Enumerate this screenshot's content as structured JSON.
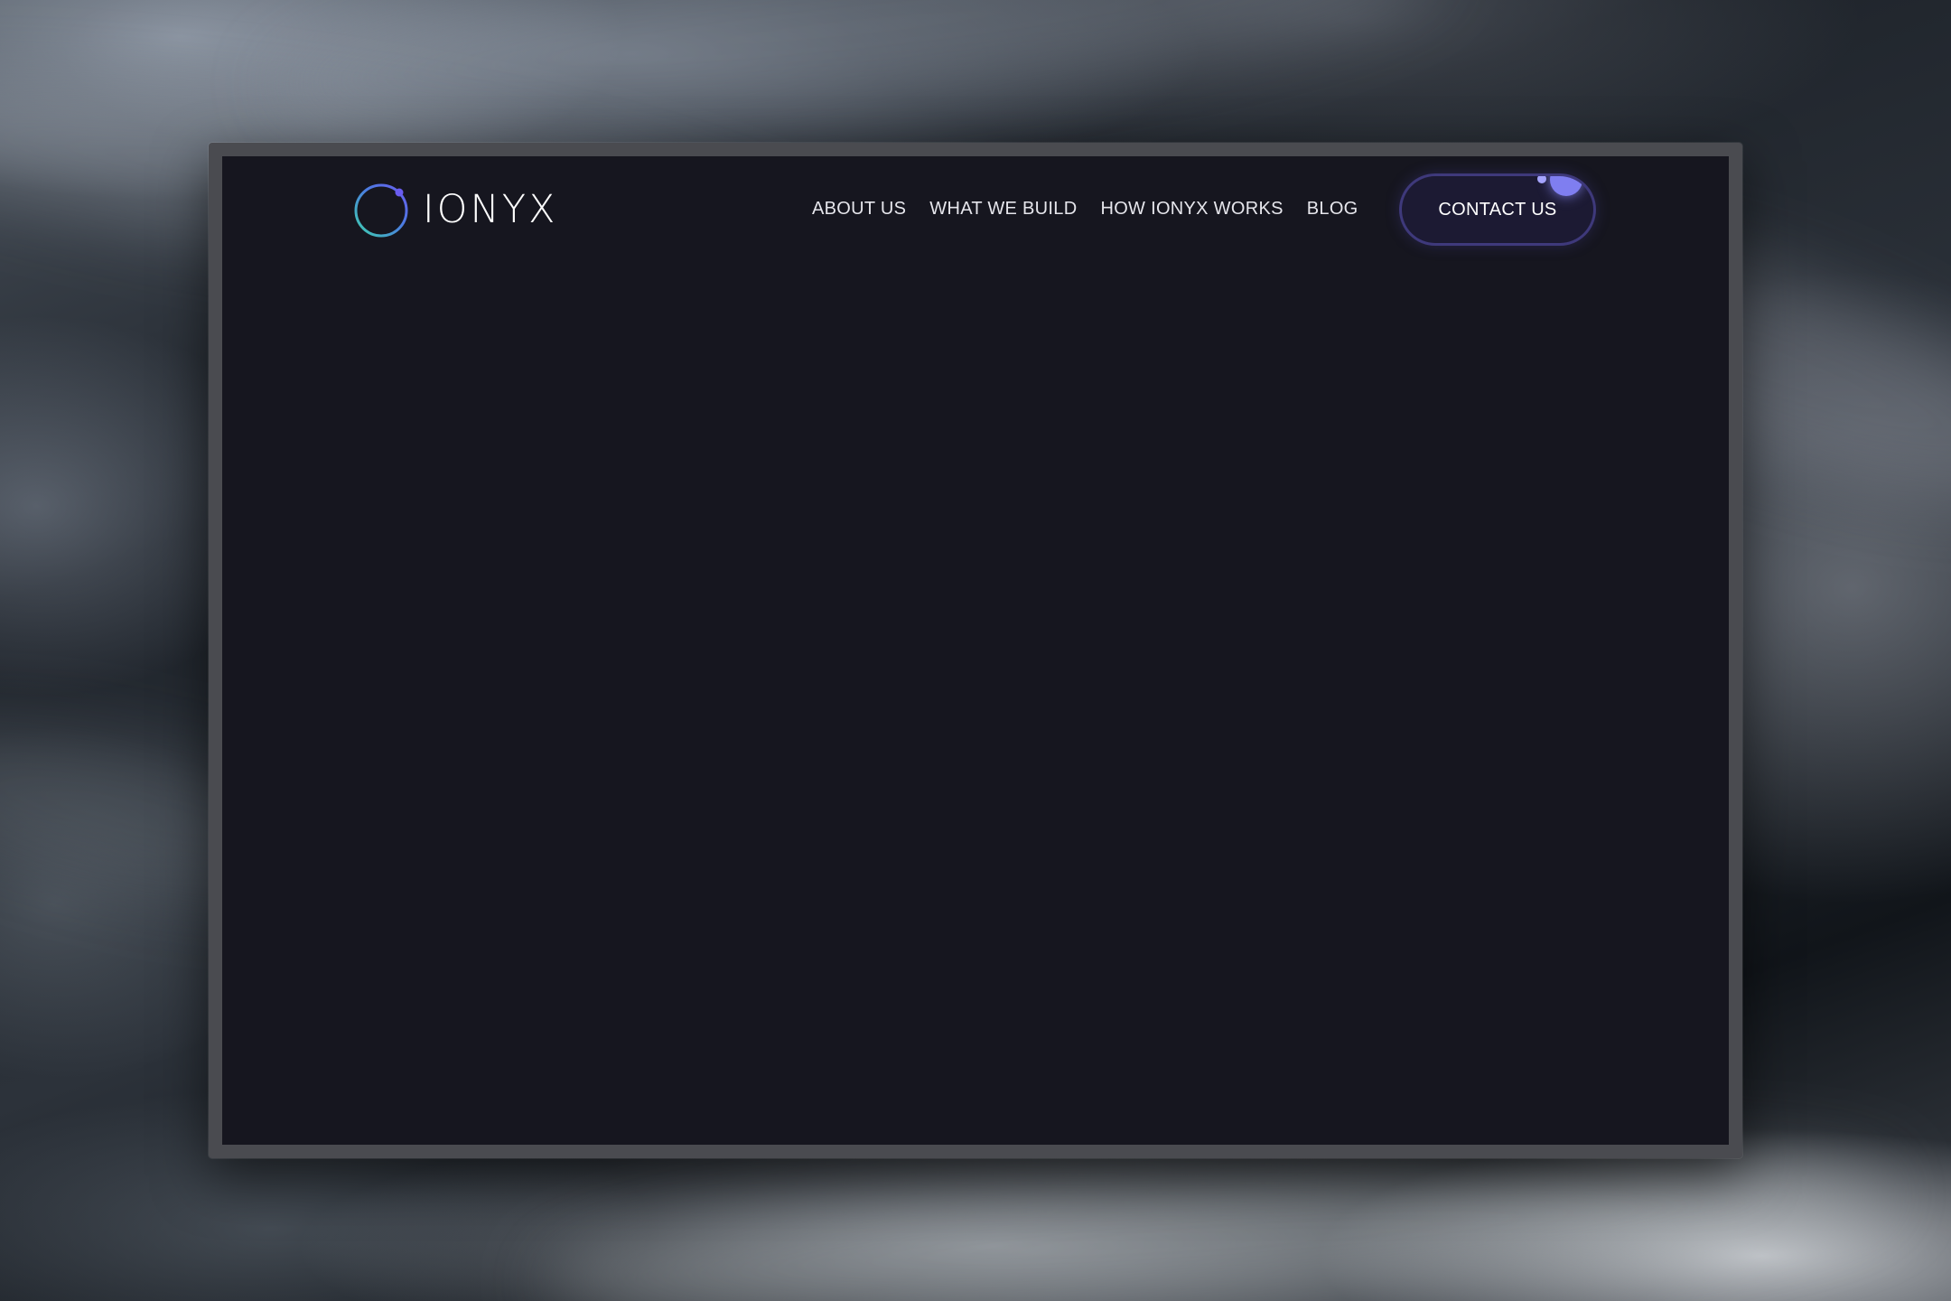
{
  "brand": {
    "name": "IONYX",
    "logo_icon": "ring-orbit-icon",
    "ring_gradient": [
      "#3fd0b0",
      "#4a7de0",
      "#6a5cf0"
    ],
    "dot_color": "#6a5cf0"
  },
  "nav": {
    "items": [
      {
        "label": "ABOUT US"
      },
      {
        "label": "WHAT WE BUILD"
      },
      {
        "label": "HOW IONYX WORKS"
      },
      {
        "label": "BLOG"
      }
    ]
  },
  "cta": {
    "label": "CONTACT US",
    "accent": "#7f7ef0"
  },
  "colors": {
    "page_bg": "#16161f",
    "frame": "#4a4b50"
  }
}
